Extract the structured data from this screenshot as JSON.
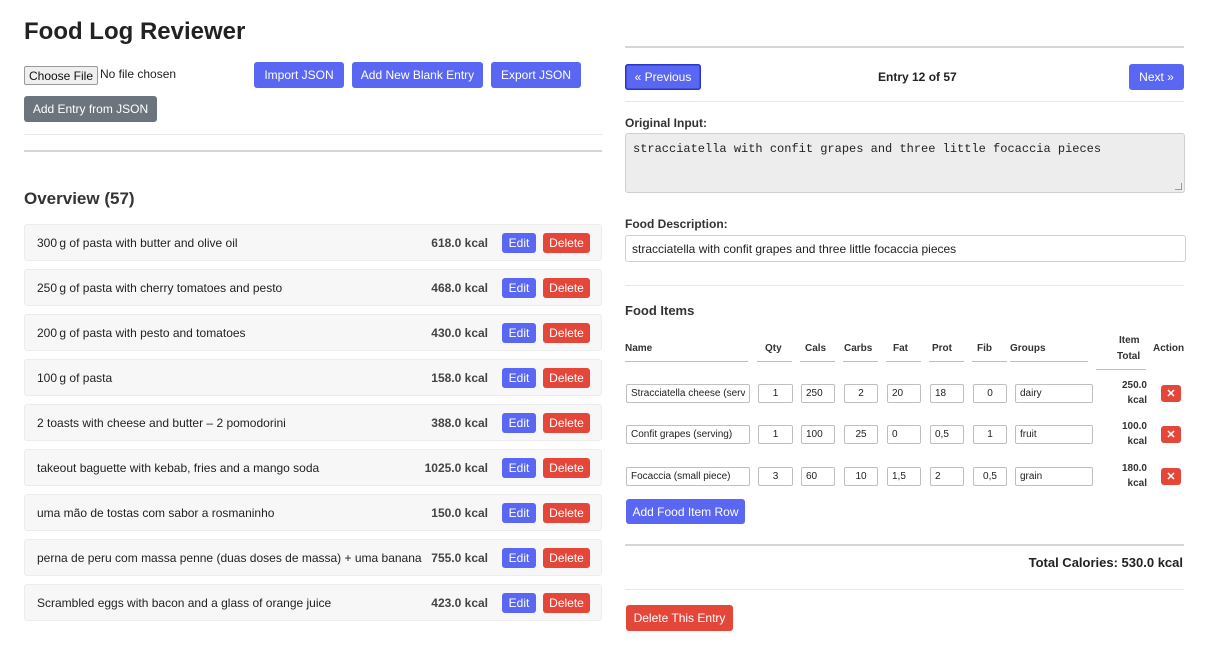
{
  "app": {
    "title": "Food Log Reviewer"
  },
  "toolbar": {
    "choose_file_label": "Choose File",
    "file_status": "No file chosen",
    "import_label": "Import JSON",
    "add_blank_label": "Add New Blank Entry",
    "export_label": "Export JSON",
    "add_from_json_label": "Add Entry from JSON"
  },
  "overview": {
    "title": "Overview (57)",
    "edit_label": "Edit",
    "delete_label": "Delete",
    "entries": [
      {
        "description": "300 g of pasta with butter and olive oil",
        "kcal": "618.0 kcal"
      },
      {
        "description": "250 g of pasta with cherry tomatoes and pesto",
        "kcal": "468.0 kcal"
      },
      {
        "description": "200 g of pasta with pesto and tomatoes",
        "kcal": "430.0 kcal"
      },
      {
        "description": "100 g of pasta",
        "kcal": "158.0 kcal"
      },
      {
        "description": "2 toasts with cheese and butter – 2 pomodorini",
        "kcal": "388.0 kcal"
      },
      {
        "description": "takeout baguette with kebab, fries and a mango soda",
        "kcal": "1025.0 kcal"
      },
      {
        "description": "uma mão de tostas com sabor a rosmaninho",
        "kcal": "150.0 kcal"
      },
      {
        "description": "perna de peru com massa penne (duas doses de massa) + uma banana",
        "kcal": "755.0 kcal"
      },
      {
        "description": "Scrambled eggs with bacon and a glass of orange juice",
        "kcal": "423.0 kcal"
      }
    ]
  },
  "navigation": {
    "previous_label": "« Previous",
    "next_label": "Next »",
    "entry_indicator": "Entry 12 of 57"
  },
  "editor": {
    "original_input_label": "Original Input:",
    "original_input": "stracciatella with confit grapes and three little focaccia pieces",
    "food_description_label": "Food Description:",
    "food_description": "stracciatella with confit grapes and three little focaccia pieces",
    "food_items_title": "Food Items",
    "columns": {
      "name": "Name",
      "qty": "Qty",
      "cals": "Cals",
      "carbs": "Carbs",
      "fat": "Fat",
      "prot": "Prot",
      "fib": "Fib",
      "groups": "Groups",
      "item_total_1": "Item",
      "item_total_2": "Total",
      "action": "Action"
    },
    "items": [
      {
        "name": "Stracciatella cheese (serving)",
        "qty": "1",
        "cals": "250",
        "carbs": "2",
        "fat": "20",
        "prot": "18",
        "fib": "0",
        "groups": "dairy",
        "total_1": "250.0",
        "total_2": "kcal",
        "remove": "✕"
      },
      {
        "name": "Confit grapes (serving)",
        "qty": "1",
        "cals": "100",
        "carbs": "25",
        "fat": "0",
        "prot": "0,5",
        "fib": "1",
        "groups": "fruit",
        "total_1": "100.0",
        "total_2": "kcal",
        "remove": "✕"
      },
      {
        "name": "Focaccia (small piece)",
        "qty": "3",
        "cals": "60",
        "carbs": "10",
        "fat": "1,5",
        "prot": "2",
        "fib": "0,5",
        "groups": "grain",
        "total_1": "180.0",
        "total_2": "kcal",
        "remove": "✕"
      }
    ],
    "add_row_label": "Add Food Item Row",
    "total_calories": "Total Calories: 530.0 kcal",
    "delete_entry_label": "Delete This Entry"
  },
  "colors": {
    "primary": "#5a67f2",
    "danger": "#e5463a",
    "secondary": "#6c757d"
  }
}
